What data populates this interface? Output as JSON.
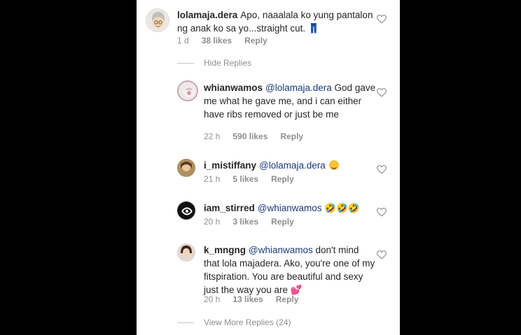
{
  "comments": [
    {
      "username": "lolamaja.dera",
      "mention": "",
      "text": "Apo, naaalala ko yung pantalon ng anak ko sa yo...straight cut. 👖",
      "time": "1 d",
      "likes": "38 likes",
      "reply": "Reply"
    },
    {
      "username": "whianwamos",
      "mention": "@lolamaja.dera",
      "text": " God gave me what he gave me, and i can either have ribs removed or just be me",
      "time": "22 h",
      "likes": "590 likes",
      "reply": "Reply"
    },
    {
      "username": "i_mistiffany",
      "mention": "@lolamaja.dera",
      "text": "",
      "emoji": "smiling-emoji",
      "time": "21 h",
      "likes": "5 likes",
      "reply": "Reply"
    },
    {
      "username": "iam_stirred",
      "mention": "@whianwamos",
      "text": " 🤣🤣🤣",
      "time": "20 h",
      "likes": "3 likes",
      "reply": "Reply"
    },
    {
      "username": "k_mngng",
      "mention": "@whianwamos",
      "text": " don't mind that lola majadera. Ako, you're one of my fitspiration. You are beautiful and sexy just the way you are 💕",
      "time": "20 h",
      "likes": "13 likes",
      "reply": "Reply"
    }
  ],
  "hide_replies": "Hide Replies",
  "view_more": "View More Replies (24)",
  "colors": {
    "background": "#000000",
    "panel": "#ffffff",
    "text": "#262626",
    "mention": "#1a3a78",
    "meta": "#8e8e8e"
  },
  "icons": {
    "like": "heart-outline-icon",
    "avatar": "avatar"
  }
}
